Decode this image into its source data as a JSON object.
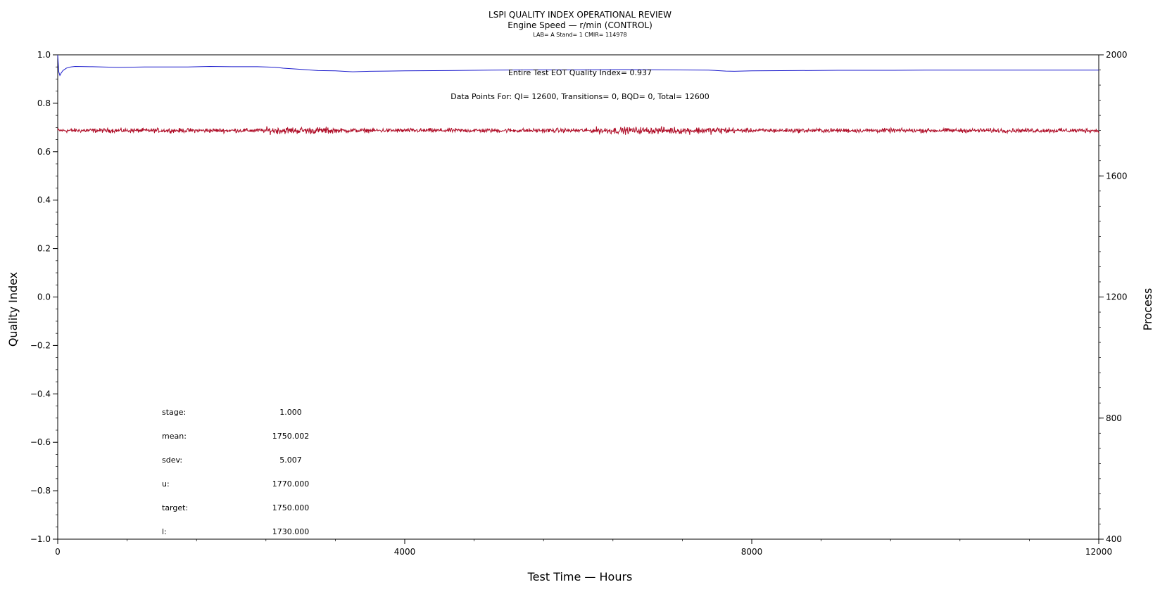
{
  "chart_data": {
    "type": "line",
    "title": "LSPI QUALITY INDEX OPERATIONAL REVIEW",
    "subtitle": "Engine Speed — r/min (CONTROL)",
    "subtitle2": "LAB= A Stand= 1 CMIR= 114978",
    "xlabel": "Test Time — Hours",
    "ylabel_left": "Quality Index",
    "ylabel_right": "Process",
    "xlim": [
      0,
      12000
    ],
    "ylim_left": [
      -1.0,
      1.0
    ],
    "ylim_right": [
      400,
      2000
    ],
    "x_ticks": [
      "0",
      "4000",
      "8000",
      "12000"
    ],
    "y_ticks_left": [
      "1.0",
      "0.8",
      "0.6",
      "0.4",
      "0.2",
      "0.0",
      "−0.2",
      "−0.4",
      "−0.6",
      "−0.8",
      "−1.0"
    ],
    "y_ticks_right": [
      "2000",
      "1600",
      "1200",
      "800",
      "400"
    ],
    "grid": false,
    "quality_index_series": {
      "axis": "left",
      "color": "#1a1acc",
      "x": [
        0,
        12,
        25,
        40,
        60,
        80,
        100,
        150,
        200,
        400,
        700,
        1000,
        1200,
        1500,
        1750,
        2000,
        2300,
        2500,
        2600,
        2800,
        3000,
        3200,
        3400,
        3600,
        3800,
        4000,
        4500,
        5000,
        5500,
        6000,
        6500,
        7000,
        7500,
        7700,
        7800,
        8000,
        8500,
        9000,
        9500,
        10000,
        10500,
        11000,
        11500,
        12000
      ],
      "values": [
        1.0,
        0.93,
        0.915,
        0.925,
        0.935,
        0.94,
        0.945,
        0.95,
        0.952,
        0.951,
        0.948,
        0.95,
        0.95,
        0.95,
        0.952,
        0.951,
        0.951,
        0.949,
        0.945,
        0.94,
        0.935,
        0.934,
        0.93,
        0.932,
        0.933,
        0.934,
        0.935,
        0.937,
        0.938,
        0.938,
        0.939,
        0.938,
        0.937,
        0.933,
        0.932,
        0.934,
        0.935,
        0.936,
        0.936,
        0.937,
        0.937,
        0.937,
        0.937,
        0.937
      ]
    },
    "process_series": {
      "axis": "right",
      "color": "#b0102a",
      "note": "Engine Speed process trace, oscillating around the mean",
      "mean": 1750.002,
      "sdev": 5.007,
      "x_range": [
        0,
        12000
      ]
    },
    "annotations": {
      "eot_line": "Entire Test EOT Quality Index=  0.937",
      "data_points_line": "Data Points For: QI= 12600, Transitions=     0, BQD=     0, Total= 12600"
    },
    "stats": [
      {
        "label": "stage:",
        "value": "1.000"
      },
      {
        "label": "mean:",
        "value": "1750.002"
      },
      {
        "label": "sdev:",
        "value": "5.007"
      },
      {
        "label": "u:",
        "value": "1770.000"
      },
      {
        "label": "target:",
        "value": "1750.000"
      },
      {
        "label": "l:",
        "value": "1730.000"
      }
    ]
  }
}
